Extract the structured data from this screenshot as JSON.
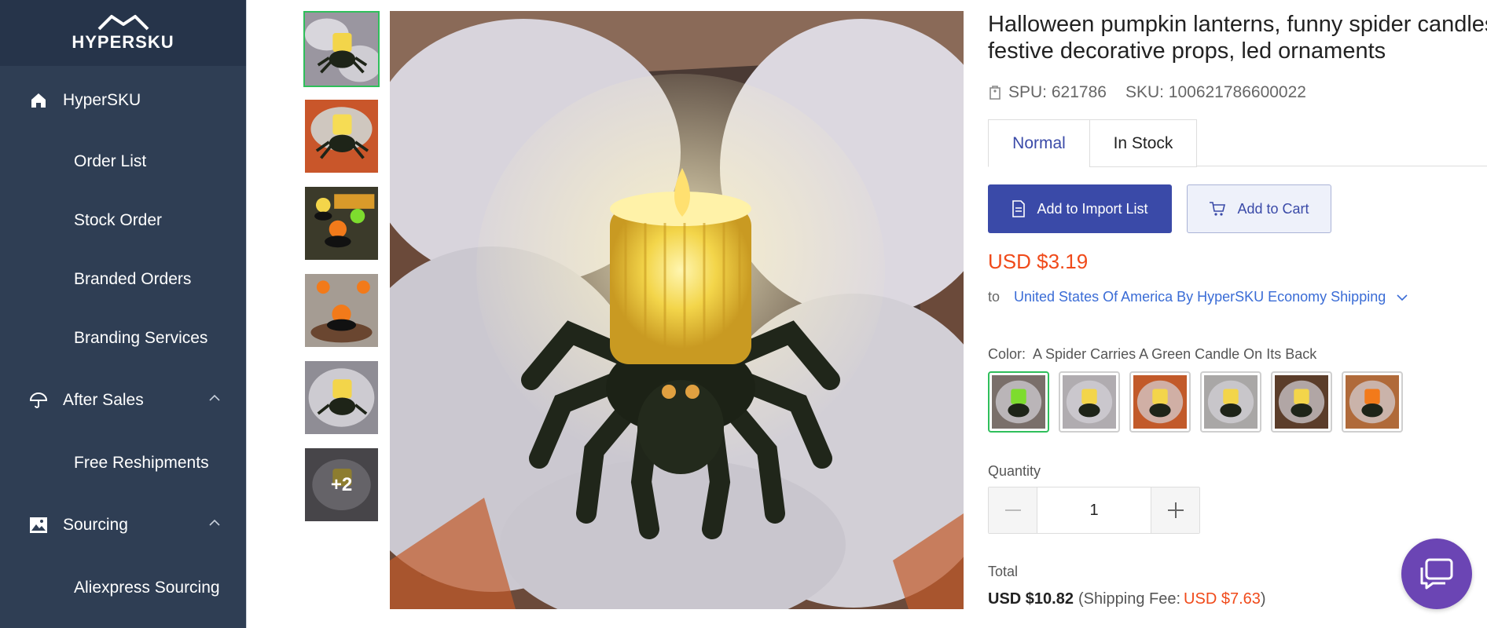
{
  "brand": {
    "name": "HYPERSKU",
    "icon": "hypersku-logo-icon"
  },
  "sidebar": {
    "items": [
      {
        "label": "HyperSKU",
        "icon": "home-icon",
        "level": "top"
      },
      {
        "label": "Order List",
        "level": "sub"
      },
      {
        "label": "Stock Order",
        "level": "sub"
      },
      {
        "label": "Branded Orders",
        "level": "sub"
      },
      {
        "label": "Branding Services",
        "level": "sub"
      },
      {
        "label": "After Sales",
        "icon": "umbrella-icon",
        "level": "top",
        "expanded": true
      },
      {
        "label": "Free Reshipments",
        "level": "sub"
      },
      {
        "label": "Sourcing",
        "icon": "image-icon",
        "level": "top",
        "expanded": true
      },
      {
        "label": "Aliexpress Sourcing",
        "level": "sub"
      }
    ]
  },
  "gallery": {
    "more_label": "+2",
    "selected_index": 0,
    "thumbnails": [
      {
        "variant": "yellow-spider"
      },
      {
        "variant": "yellow-spider-orange-bg"
      },
      {
        "variant": "multi-color-spiders"
      },
      {
        "variant": "orange-spiders"
      },
      {
        "variant": "yellow-spider"
      },
      {
        "variant": "more"
      }
    ]
  },
  "product": {
    "title": "Halloween pumpkin lanterns, funny spider candles, festive decorative props, led ornaments",
    "spu_label": "SPU: 621786",
    "sku_label": "SKU: 100621786600022",
    "tabs": [
      {
        "label": "Normal",
        "active": true
      },
      {
        "label": "In Stock",
        "active": false
      }
    ],
    "import_button": "Add to Import List",
    "cart_button": "Add to Cart",
    "price": "USD $3.19",
    "shipping_to_label": "to",
    "shipping_destination": "United States Of America By HyperSKU Economy Shipping",
    "color_label": "Color:",
    "color_value": "A Spider Carries A Green Candle On Its Back",
    "swatches": [
      {
        "candle": "#7ddc2e",
        "bg": "#7a6f6a",
        "active": true
      },
      {
        "candle": "#f3d54a",
        "bg": "#b0acb0",
        "active": false
      },
      {
        "candle": "#f3d54a",
        "bg": "#c25a2a",
        "active": false
      },
      {
        "candle": "#f3d54a",
        "bg": "#a9a7a6",
        "active": false
      },
      {
        "candle": "#f3d54a",
        "bg": "#5b3d2a",
        "active": false
      },
      {
        "candle": "#f27a1a",
        "bg": "#b06a3a",
        "active": false
      }
    ],
    "quantity_label": "Quantity",
    "quantity": "1",
    "total_label": "Total",
    "total_amount": "USD $10.82",
    "shipping_fee_label": "(Shipping Fee:",
    "shipping_fee": "USD $7.63",
    "shipping_fee_close": ")"
  },
  "colors": {
    "sidebar_bg": "#2f3e54",
    "accent": "#3a4aa8",
    "price": "#f04a1a",
    "link": "#3a6cd6",
    "active_border": "#2fbf5b",
    "chat": "#6b45b4"
  },
  "chat": {
    "icon": "chat-bubbles-icon"
  }
}
